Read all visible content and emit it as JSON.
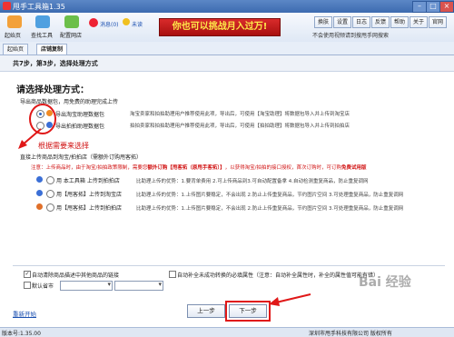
{
  "app": {
    "title": "甩手工具箱1.35"
  },
  "toolbar": {
    "items": [
      {
        "label": "起始页",
        "color": "#f3a13a"
      },
      {
        "label": "查找工具",
        "color": "#4fa0e0"
      },
      {
        "label": "配置网店",
        "color": "#6cbf4a"
      }
    ],
    "message": "消息(0)",
    "unread": "未读",
    "promo": "你也可以挑战月入过万!",
    "buttons": [
      "换肤",
      "设置",
      "日志",
      "反馈",
      "帮助",
      "关于",
      "官网"
    ],
    "note": "不会使用视频请到搜甩手网搜索"
  },
  "tabs": [
    "起始页",
    "店铺复制"
  ],
  "step_header": "共7步，第3步，选择处理方式",
  "main": {
    "title": "请选择处理方式：",
    "section1": "导出商品数据包，用免费的助理完成上传",
    "option1": "导出淘宝助理数据包",
    "option1_desc": "淘宝卖家和拍拍助理用户推荐使用此项，导出后，可使用【淘宝助理】将数据包导入并上传到淘宝店",
    "option2": "导出拍拍助理数据包",
    "option2_desc": "拍拍卖家和拍拍助理用户推荐使用此项，导出后，可使用【拍拍助理】将数据包导入并上传到拍拍店",
    "annotation": "根据需要来选择",
    "section2": "直接上传商品到淘宝/拍拍店（需额外订购甩客拓）",
    "notice_lead": "注意：上传商品时，由于淘宝/拍拍政策限制，需要您",
    "notice_mid": "额外订购【甩客拓（原甩手客拓）】",
    "notice_tail": "，以获得淘宝/拍拍的接口授权，首次订购时，可订购",
    "notice_free": "免费试用版",
    "rows": [
      {
        "label": "用 本工具箱 上传到拍拍店",
        "desc": "比助理上传的优势：1.要背单费用 2.可上传商品到3.可自动配置备拿 4.自动检测重复商品，防止重复调网",
        "icon": "#3b6fd6"
      },
      {
        "label": "用【甩客拓】上传到淘宝店",
        "desc": "比助理上传的优势：1.上传图片要稳定，不会出现 2.防止上传重复商品，节约图片空间 3.可处理重复商品，防止重复调网",
        "icon": "#3b6fd6"
      },
      {
        "label": "用【甩客拓】上传到拍拍店",
        "desc": "比助理上传的优势：1.上传图片要稳定，不会出现 2.防止上传重复商品，节约图片空间 3.可处理重复商品，防止重复调网",
        "icon": "#e0702a"
      }
    ],
    "check1": "自动清除商品描述中其他商品的链接",
    "check2": "自动补全未成功转换的必填属性（注意：自动补全属性时，补全的属性值可能有错）",
    "check3": "默认省市",
    "prev": "上一步",
    "next": "下一步",
    "restart": "重新开始"
  },
  "status": {
    "version": "版本号:1.35.00",
    "company": "深圳市甩手科技有限公司 版权所有"
  },
  "watermark": "Bai 经验"
}
